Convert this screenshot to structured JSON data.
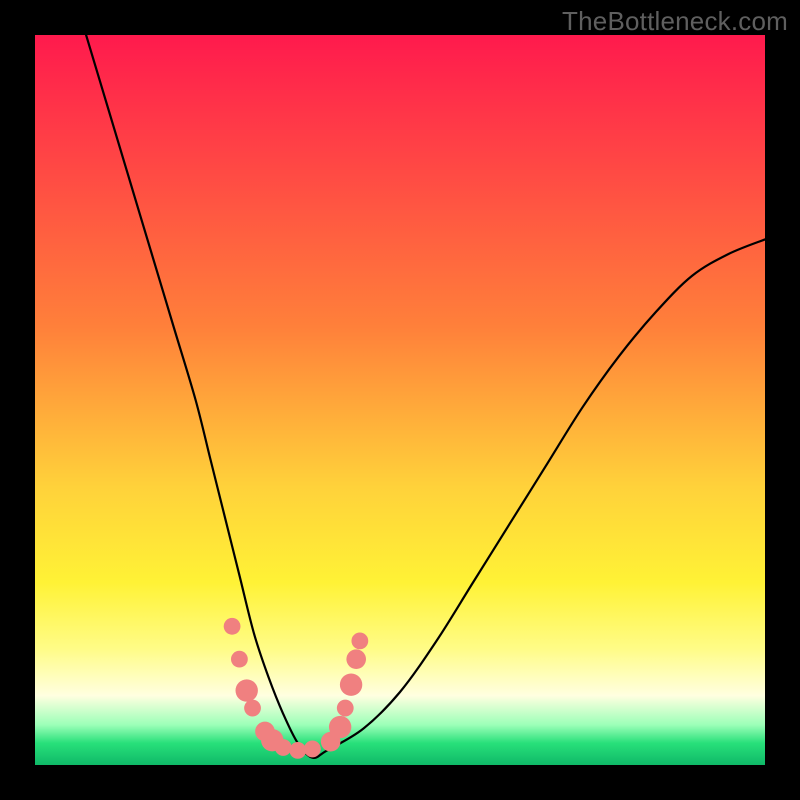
{
  "watermark": "TheBottleneck.com",
  "chart_data": {
    "type": "line",
    "title": "",
    "xlabel": "",
    "ylabel": "",
    "xlim": [
      0,
      100
    ],
    "ylim": [
      0,
      100
    ],
    "grid": false,
    "legend": false,
    "gradient_stops": [
      {
        "offset": 0,
        "color": "#ff1a4d"
      },
      {
        "offset": 0.4,
        "color": "#ff803a"
      },
      {
        "offset": 0.62,
        "color": "#ffd23a"
      },
      {
        "offset": 0.75,
        "color": "#fff236"
      },
      {
        "offset": 0.84,
        "color": "#fffc86"
      },
      {
        "offset": 0.905,
        "color": "#ffffe0"
      },
      {
        "offset": 0.945,
        "color": "#9cffb8"
      },
      {
        "offset": 0.97,
        "color": "#28e07a"
      },
      {
        "offset": 1.0,
        "color": "#0fb968"
      }
    ],
    "series": [
      {
        "name": "bottleneck-curve",
        "x": [
          7,
          10,
          13,
          16,
          19,
          22,
          24,
          26,
          28,
          30,
          32,
          34,
          36,
          38,
          40,
          45,
          50,
          55,
          60,
          65,
          70,
          75,
          80,
          85,
          90,
          95,
          100
        ],
        "values": [
          100,
          90,
          80,
          70,
          60,
          50,
          42,
          34,
          26,
          18,
          12,
          7,
          3,
          1,
          2,
          5,
          10,
          17,
          25,
          33,
          41,
          49,
          56,
          62,
          67,
          70,
          72
        ]
      }
    ],
    "markers": [
      {
        "x": 27.0,
        "y": 19.0,
        "r": 1.2
      },
      {
        "x": 28.0,
        "y": 14.5,
        "r": 1.2
      },
      {
        "x": 29.0,
        "y": 10.2,
        "r": 1.6
      },
      {
        "x": 29.8,
        "y": 7.8,
        "r": 1.2
      },
      {
        "x": 31.5,
        "y": 4.6,
        "r": 1.4
      },
      {
        "x": 32.5,
        "y": 3.4,
        "r": 1.6
      },
      {
        "x": 34.0,
        "y": 2.4,
        "r": 1.2
      },
      {
        "x": 36.0,
        "y": 2.0,
        "r": 1.2
      },
      {
        "x": 38.0,
        "y": 2.2,
        "r": 1.2
      },
      {
        "x": 40.5,
        "y": 3.2,
        "r": 1.4
      },
      {
        "x": 41.8,
        "y": 5.2,
        "r": 1.6
      },
      {
        "x": 42.5,
        "y": 7.8,
        "r": 1.2
      },
      {
        "x": 43.3,
        "y": 11.0,
        "r": 1.6
      },
      {
        "x": 44.0,
        "y": 14.5,
        "r": 1.4
      },
      {
        "x": 44.5,
        "y": 17.0,
        "r": 1.2
      }
    ],
    "marker_color": "#f08080"
  }
}
